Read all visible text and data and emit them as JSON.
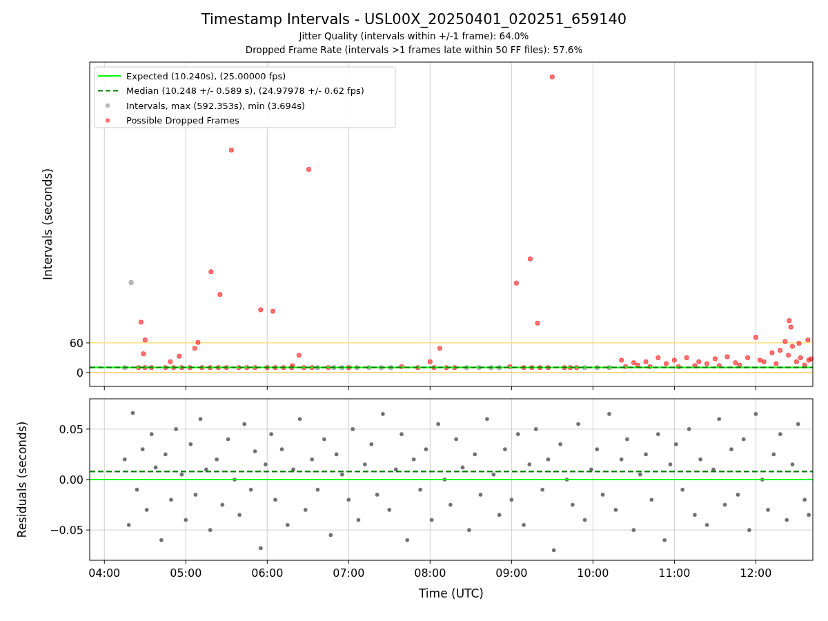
{
  "figure": {
    "title": "Timestamp Intervals - USL00X_20250401_020251_659140",
    "subtitles": [
      "Jitter Quality (intervals within +/-1 frame): 64.0%",
      "Dropped Frame Rate (intervals >1 frames late within 50 FF files): 57.6%"
    ]
  },
  "panels": [
    {
      "chart_data": {
        "type": "scatter",
        "ylabel": "Intervals (seconds)",
        "xlim": [
          3.82,
          12.7
        ],
        "ylim": [
          -28,
          628
        ],
        "yticks": [
          {
            "value": 0,
            "label": "0"
          },
          {
            "value": 60,
            "label": "60"
          }
        ],
        "legend": true,
        "ref_lines": [
          {
            "axis": "y",
            "value": 60,
            "color": "#ffd966"
          },
          {
            "axis": "y",
            "value": 0,
            "color": "#ffc04d"
          }
        ],
        "grid": true,
        "series": [
          {
            "name": "Expected (10.240s), (25.00000 fps)",
            "type": "line",
            "color": "#00ff00",
            "x": [
              3.82,
              12.7
            ],
            "values": [
              10.24,
              10.24
            ]
          },
          {
            "name": "Median (10.248 +/- 0.589 s), (24.97978 +/- 0.62 fps)",
            "type": "line",
            "line_style": "dashed",
            "color": "#008000",
            "x": [
              3.82,
              12.7
            ],
            "values": [
              10.248,
              10.248
            ]
          },
          {
            "name": "Intervals, max (592.353s), min (3.694s)",
            "type": "scatter",
            "color": "#808080",
            "x": [
              4.25,
              4.33,
              6.62,
              6.82,
              6.92,
              7.1,
              7.25,
              7.4,
              7.52,
              8.45,
              8.6,
              8.75,
              8.85,
              9.9,
              10.05,
              10.2
            ],
            "values": [
              10,
              182,
              10,
              10,
              10,
              10,
              10,
              10,
              10,
              10,
              10,
              10,
              10,
              10,
              10,
              10
            ]
          },
          {
            "name": "Possible Dropped Frames",
            "type": "scatter",
            "color": "#ff0000",
            "x": [
              4.45,
              4.5,
              4.48,
              4.81,
              4.92,
              5.11,
              5.15,
              5.31,
              5.42,
              5.56,
              5.92,
              6.07,
              6.31,
              6.39,
              6.51,
              6.75,
              7.0,
              7.65,
              8.0,
              8.12,
              8.98,
              9.06,
              9.23,
              9.32,
              9.5,
              12.0,
              12.36,
              12.41,
              12.43,
              12.45,
              12.53,
              12.64,
              12.65,
              4.42,
              4.5,
              4.58,
              4.75,
              4.85,
              4.95,
              5.05,
              5.2,
              5.3,
              5.4,
              5.5,
              5.65,
              5.75,
              5.85,
              6.0,
              6.1,
              6.2,
              6.3,
              6.45,
              6.55,
              7.85,
              8.05,
              8.2,
              8.3,
              9.15,
              9.25,
              9.35,
              9.45,
              9.65,
              9.72,
              9.8,
              10.35,
              10.4,
              10.5,
              10.55,
              10.65,
              10.7,
              10.8,
              10.9,
              11.0,
              11.05,
              11.15,
              11.25,
              11.3,
              11.4,
              11.5,
              11.55,
              11.65,
              11.75,
              11.8,
              11.9,
              12.05,
              12.1,
              12.2,
              12.25,
              12.3,
              12.4,
              12.5,
              12.55,
              12.6,
              12.68
            ],
            "values": [
              102,
              66,
              38,
              22,
              33,
              49,
              61,
              204,
              158,
              450,
              127,
              124,
              14,
              35,
              411,
              10,
              10,
              12,
              22,
              49,
              12,
              181,
              230,
              100,
              598,
              71,
              63,
              105,
              92,
              53,
              59,
              66,
              25,
              10,
              10,
              10,
              10,
              10,
              10,
              10,
              10,
              10,
              10,
              10,
              10,
              10,
              10,
              10,
              10,
              10,
              10,
              10,
              10,
              10,
              10,
              10,
              10,
              10,
              10,
              10,
              10,
              10,
              10,
              10,
              25,
              12,
              20,
              15,
              22,
              12,
              30,
              18,
              25,
              12,
              30,
              14,
              22,
              18,
              28,
              14,
              32,
              20,
              15,
              30,
              25,
              22,
              40,
              18,
              45,
              35,
              22,
              30,
              15,
              28
            ]
          }
        ]
      }
    },
    {
      "chart_data": {
        "type": "scatter",
        "xlabel": "Time (UTC)",
        "ylabel": "Residuals (seconds)",
        "xlim": [
          3.82,
          12.7
        ],
        "ylim": [
          -0.08,
          0.08
        ],
        "grid": true,
        "xticks": [
          {
            "value": 4,
            "label": "04:00"
          },
          {
            "value": 5,
            "label": "05:00"
          },
          {
            "value": 6,
            "label": "06:00"
          },
          {
            "value": 7,
            "label": "07:00"
          },
          {
            "value": 8,
            "label": "08:00"
          },
          {
            "value": 9,
            "label": "09:00"
          },
          {
            "value": 10,
            "label": "10:00"
          },
          {
            "value": 11,
            "label": "11:00"
          },
          {
            "value": 12,
            "label": "12:00"
          }
        ],
        "yticks": [
          {
            "value": -0.05,
            "label": "−0.05"
          },
          {
            "value": 0,
            "label": "0.00"
          },
          {
            "value": 0.05,
            "label": "0.05"
          }
        ],
        "series": [
          {
            "type": "line",
            "color": "#00ff00",
            "x": [
              3.82,
              12.7
            ],
            "values": [
              0,
              0
            ]
          },
          {
            "type": "line",
            "line_style": "dashed",
            "color": "#008000",
            "x": [
              3.82,
              12.7
            ],
            "values": [
              0.008,
              0.008
            ]
          },
          {
            "type": "scatter",
            "color": "#707070",
            "x": [
              4.25,
              4.3,
              4.35,
              4.4,
              4.47,
              4.52,
              4.58,
              4.63,
              4.7,
              4.75,
              4.82,
              4.88,
              4.95,
              5.0,
              5.06,
              5.12,
              5.18,
              5.25,
              5.3,
              5.38,
              5.45,
              5.52,
              5.6,
              5.66,
              5.72,
              5.8,
              5.85,
              5.92,
              5.98,
              6.05,
              6.1,
              6.18,
              6.25,
              6.32,
              6.4,
              6.47,
              6.55,
              6.62,
              6.7,
              6.78,
              6.85,
              6.92,
              7.0,
              7.05,
              7.12,
              7.2,
              7.28,
              7.35,
              7.42,
              7.5,
              7.58,
              7.65,
              7.72,
              7.8,
              7.88,
              7.95,
              8.02,
              8.1,
              8.18,
              8.25,
              8.32,
              8.4,
              8.48,
              8.55,
              8.62,
              8.7,
              8.78,
              8.85,
              8.92,
              9.0,
              9.08,
              9.15,
              9.22,
              9.3,
              9.38,
              9.45,
              9.52,
              9.6,
              9.68,
              9.75,
              9.82,
              9.9,
              9.98,
              10.05,
              10.12,
              10.2,
              10.28,
              10.35,
              10.42,
              10.5,
              10.58,
              10.65,
              10.72,
              10.8,
              10.88,
              10.95,
              11.02,
              11.1,
              11.18,
              11.25,
              11.32,
              11.4,
              11.48,
              11.55,
              11.62,
              11.7,
              11.78,
              11.85,
              11.92,
              12.0,
              12.08,
              12.15,
              12.22,
              12.3,
              12.38,
              12.45,
              12.52,
              12.6,
              12.65
            ],
            "values": [
              0.02,
              -0.045,
              0.066,
              -0.01,
              0.03,
              -0.03,
              0.045,
              0.012,
              -0.06,
              0.025,
              -0.02,
              0.05,
              0.005,
              -0.04,
              0.035,
              -0.015,
              0.06,
              0.01,
              -0.05,
              0.02,
              -0.025,
              0.04,
              0.0,
              -0.035,
              0.055,
              -0.01,
              0.028,
              -0.068,
              0.015,
              0.045,
              -0.02,
              0.03,
              -0.045,
              0.01,
              0.06,
              -0.03,
              0.02,
              -0.01,
              0.04,
              -0.055,
              0.025,
              0.005,
              -0.02,
              0.05,
              -0.04,
              0.015,
              0.035,
              -0.015,
              0.065,
              -0.03,
              0.01,
              0.045,
              -0.06,
              0.02,
              -0.01,
              0.03,
              -0.04,
              0.055,
              0.0,
              -0.025,
              0.04,
              0.012,
              -0.05,
              0.025,
              -0.015,
              0.06,
              0.005,
              -0.035,
              0.03,
              -0.02,
              0.045,
              -0.045,
              0.015,
              0.05,
              -0.01,
              0.02,
              -0.07,
              0.035,
              0.0,
              -0.025,
              0.055,
              -0.04,
              0.01,
              0.03,
              -0.015,
              0.065,
              -0.03,
              0.02,
              0.04,
              -0.05,
              0.005,
              0.025,
              -0.02,
              0.045,
              -0.06,
              0.015,
              0.035,
              -0.01,
              0.05,
              -0.035,
              0.02,
              -0.045,
              0.01,
              0.06,
              -0.025,
              0.03,
              -0.015,
              0.04,
              -0.05,
              0.065,
              0.0,
              -0.03,
              0.025,
              0.045,
              -0.04,
              0.015,
              0.055,
              -0.02,
              -0.035
            ]
          }
        ]
      }
    }
  ]
}
